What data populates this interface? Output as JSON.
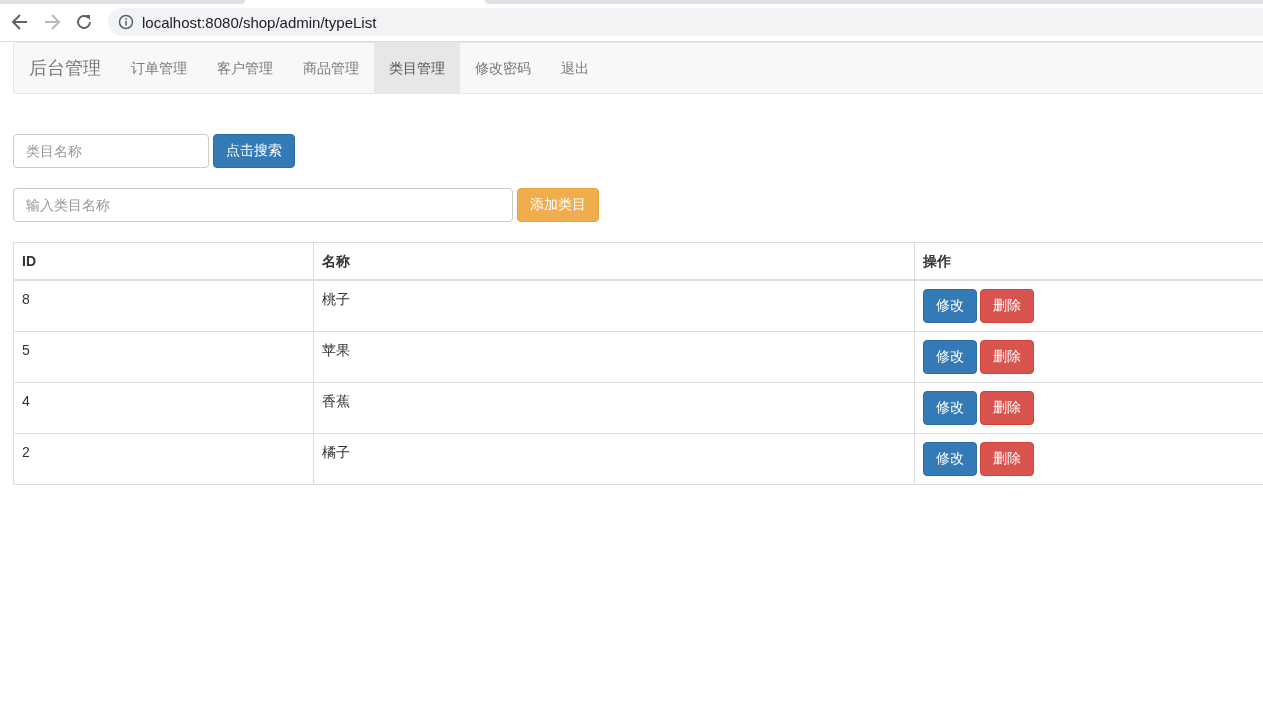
{
  "browser": {
    "back_disabled": false,
    "forward_disabled": true,
    "url": "localhost:8080/shop/admin/typeList"
  },
  "navbar": {
    "brand": "后台管理",
    "items": [
      {
        "label": "订单管理",
        "selected": false
      },
      {
        "label": "客户管理",
        "selected": false
      },
      {
        "label": "商品管理",
        "selected": false
      },
      {
        "label": "类目管理",
        "selected": true
      },
      {
        "label": "修改密码",
        "selected": false
      },
      {
        "label": "退出",
        "selected": false
      }
    ]
  },
  "search": {
    "placeholder": "类目名称",
    "button": "点击搜索"
  },
  "add": {
    "placeholder": "输入类目名称",
    "button": "添加类目"
  },
  "table": {
    "columns": [
      "ID",
      "名称",
      "操作"
    ],
    "rows": [
      {
        "id": "8",
        "name": "桃子",
        "actions": [
          {
            "label": "修改",
            "kind": "primary"
          },
          {
            "label": "删除",
            "kind": "danger"
          }
        ]
      },
      {
        "id": "5",
        "name": "苹果",
        "actions": [
          {
            "label": "修改",
            "kind": "primary"
          },
          {
            "label": "删除",
            "kind": "danger"
          }
        ]
      },
      {
        "id": "4",
        "name": "香蕉",
        "actions": [
          {
            "label": "修改",
            "kind": "primary"
          },
          {
            "label": "删除",
            "kind": "danger"
          }
        ]
      },
      {
        "id": "2",
        "name": "橘子",
        "actions": [
          {
            "label": "修改",
            "kind": "primary"
          },
          {
            "label": "删除",
            "kind": "danger"
          }
        ]
      }
    ]
  }
}
